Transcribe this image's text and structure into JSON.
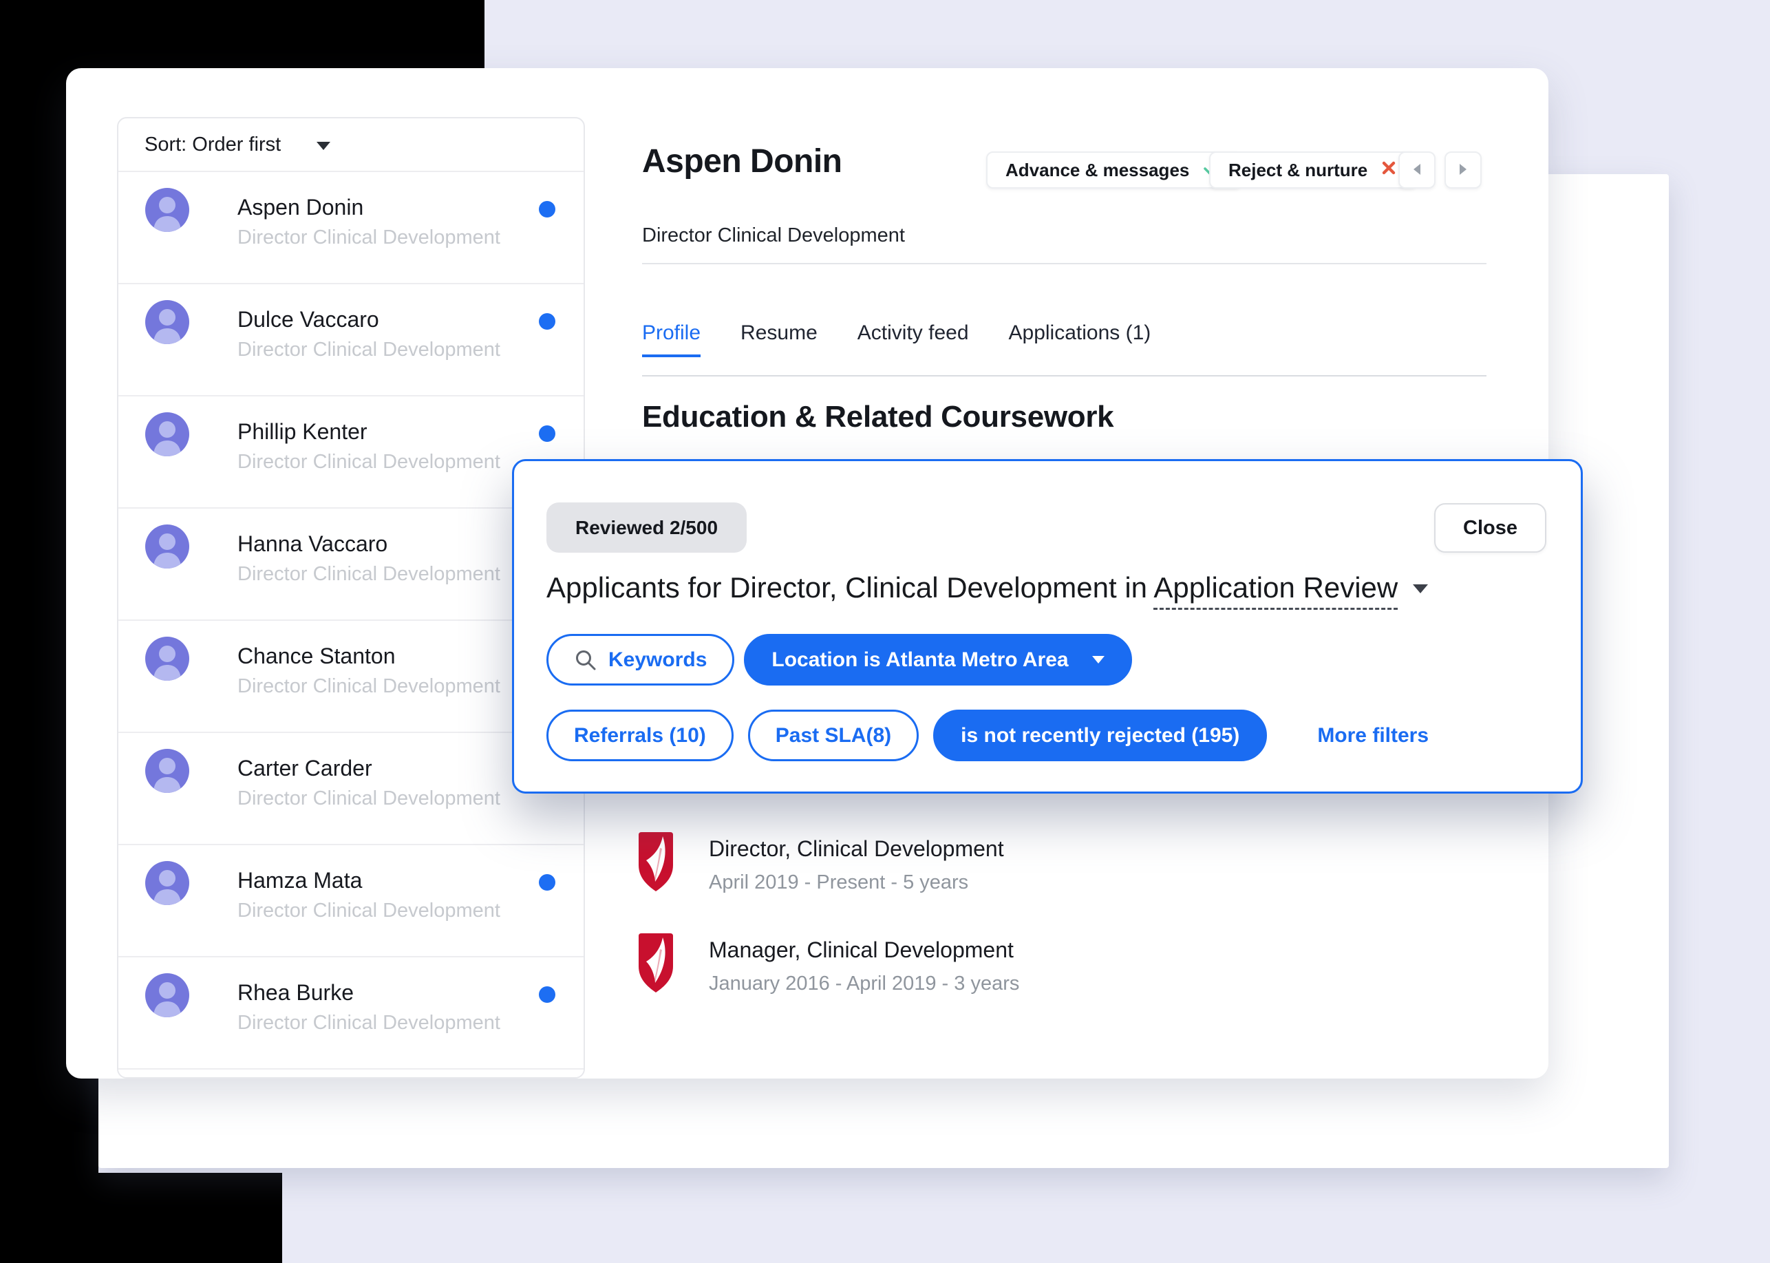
{
  "sidebar": {
    "sort_label": "Sort: Order first",
    "sort_caret_icon": "caret-down",
    "candidates": [
      {
        "name": "Aspen Donin",
        "title": "Director Clinical Development",
        "unread_dot": true
      },
      {
        "name": "Dulce Vaccaro",
        "title": "Director Clinical Development",
        "unread_dot": true
      },
      {
        "name": "Phillip Kenter",
        "title": "Director Clinical Development",
        "unread_dot": true
      },
      {
        "name": "Hanna Vaccaro",
        "title": "Director Clinical Development",
        "unread_dot": true
      },
      {
        "name": "Chance Stanton",
        "title": "Director Clinical Development",
        "unread_dot": true
      },
      {
        "name": "Carter Carder",
        "title": "Director Clinical Development",
        "unread_dot": true
      },
      {
        "name": "Hamza Mata",
        "title": "Director Clinical Development",
        "unread_dot": true
      },
      {
        "name": "Rhea Burke",
        "title": "Director Clinical Development",
        "unread_dot": true
      }
    ]
  },
  "profile": {
    "name": "Aspen Donin",
    "job_title": "Director Clinical Development",
    "advance_button": "Advance & messages",
    "advance_icon": "check",
    "reject_button": "Reject & nurture",
    "reject_icon": "x-mark",
    "prev_icon": "chevron-left",
    "next_icon": "chevron-right",
    "tabs": [
      {
        "label": "Profile",
        "active": true
      },
      {
        "label": "Resume",
        "active": false
      },
      {
        "label": "Activity feed",
        "active": false
      },
      {
        "label": "Applications (1)",
        "active": false
      }
    ],
    "section_heading": "Education & Related Coursework"
  },
  "modal": {
    "reviewed_badge": "Reviewed 2/500",
    "close_label": "Close",
    "title_prefix": "Applicants for Director, Clinical Development in ",
    "title_stage": "Application Review",
    "stage_caret_icon": "caret-down",
    "filter_rows": [
      [
        {
          "label": "Keywords",
          "variant": "outlined",
          "icon": "search"
        },
        {
          "label": "Location is Atlanta Metro Area",
          "variant": "filled",
          "caret": true
        }
      ],
      [
        {
          "label": "Referrals (10)",
          "variant": "outlined"
        },
        {
          "label": "Past SLA(8)",
          "variant": "outlined"
        },
        {
          "label": "is not recently rejected (195)",
          "variant": "filled"
        }
      ]
    ],
    "more_filters_label": "More filters"
  },
  "experience": {
    "employer_logo_icon": "crimson-shield-quill",
    "items": [
      {
        "role": "Director, Clinical Development",
        "dates": "April 2019 - Present - 5 years"
      },
      {
        "role": "Manager, Clinical Development",
        "dates": "January 2016 - April 2019 - 3 years"
      }
    ]
  },
  "colors": {
    "accent_blue": "#1a6cf2",
    "dot_blue": "#1d6ef3",
    "check_green": "#57c9a0",
    "x_red": "#e4573d",
    "shield_crimson": "#c8102e",
    "avatar_purple": "#7477dc",
    "avatar_silhouette": "#b4b8f0",
    "background_lavender": "#e9eaf6",
    "background_black": "#000000"
  }
}
